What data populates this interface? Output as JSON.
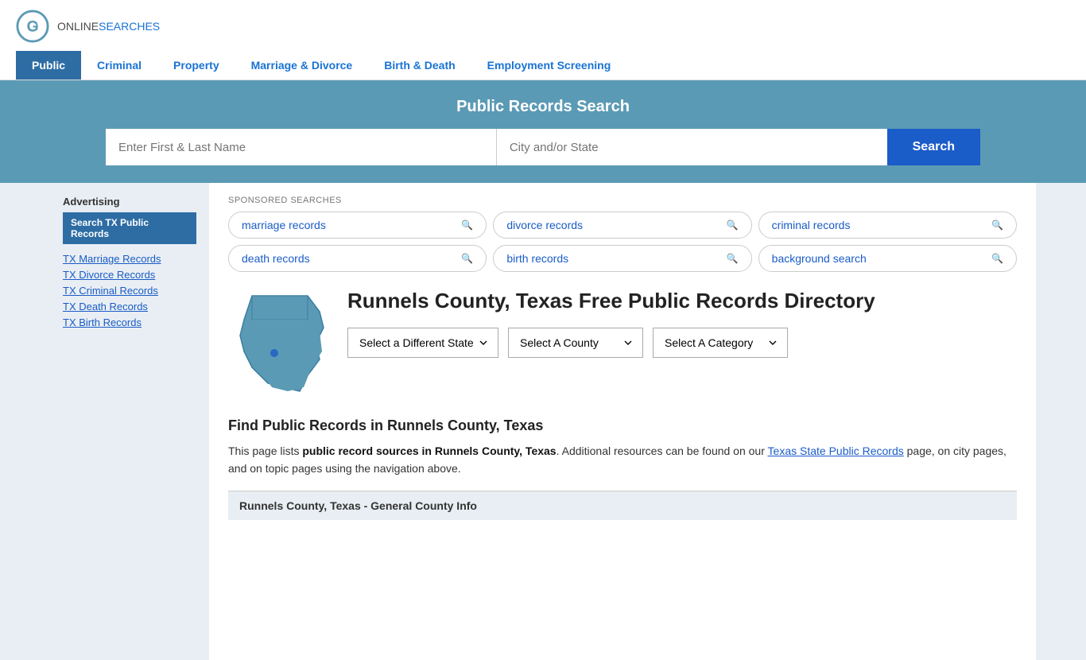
{
  "logo": {
    "online": "ONLINE",
    "searches": "SEARCHES"
  },
  "nav": {
    "items": [
      {
        "label": "Public",
        "active": true
      },
      {
        "label": "Criminal",
        "active": false
      },
      {
        "label": "Property",
        "active": false
      },
      {
        "label": "Marriage & Divorce",
        "active": false
      },
      {
        "label": "Birth & Death",
        "active": false
      },
      {
        "label": "Employment Screening",
        "active": false
      }
    ]
  },
  "search_section": {
    "title": "Public Records Search",
    "name_placeholder": "Enter First & Last Name",
    "location_placeholder": "City and/or State",
    "button_label": "Search"
  },
  "sponsored": {
    "label": "SPONSORED SEARCHES",
    "items": [
      "marriage records",
      "divorce records",
      "criminal records",
      "death records",
      "birth records",
      "background search"
    ]
  },
  "county": {
    "title": "Runnels County, Texas Free Public Records Directory"
  },
  "dropdowns": {
    "state_label": "Select a Different State",
    "county_label": "Select A County",
    "category_label": "Select A Category"
  },
  "find_section": {
    "title": "Find Public Records in Runnels County, Texas",
    "text_before": "This page lists ",
    "bold_text": "public record sources in Runnels County, Texas",
    "text_middle": ". Additional resources can be found on our ",
    "link_text": "Texas State Public Records",
    "text_after": " page, on city pages, and on topic pages using the navigation above."
  },
  "general_info_bar": "Runnels County, Texas - General County Info",
  "sidebar": {
    "ad_title": "Advertising",
    "ad_button": "Search TX Public Records",
    "links": [
      "TX Marriage Records",
      "TX Divorce Records",
      "TX Criminal Records",
      "TX Death Records",
      "TX Birth Records"
    ]
  }
}
